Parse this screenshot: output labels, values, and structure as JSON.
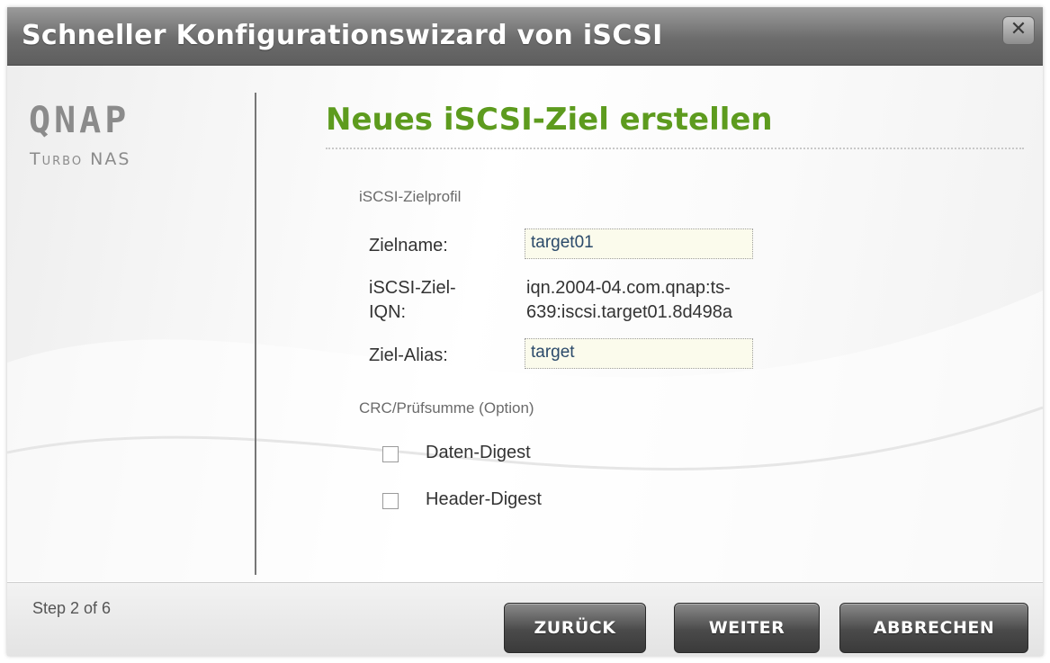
{
  "window": {
    "title": "Schneller Konfigurationswizard von iSCSI",
    "close_glyph": "✕"
  },
  "branding": {
    "logo": "QNAP",
    "subtitle": "Turbo NAS"
  },
  "main": {
    "heading": "Neues iSCSI-Ziel erstellen",
    "profile_section": "iSCSI-Zielprofil",
    "fields": {
      "target_name_label": "Zielname:",
      "target_name_value": "target01",
      "iqn_label_line1": "iSCSI-Ziel-",
      "iqn_label_line2": "IQN:",
      "iqn_value_line1": "iqn.2004-04.com.qnap:ts-",
      "iqn_value_line2": "639:iscsi.target01.8d498a",
      "alias_label": "Ziel-Alias:",
      "alias_value": "target"
    },
    "crc_section": "CRC/Prüfsumme (Option)",
    "checkboxes": {
      "data_digest": "Daten-Digest",
      "header_digest": "Header-Digest"
    }
  },
  "footer": {
    "step": "Step 2 of 6",
    "back_label": "ZURÜCK",
    "next_label": "WEITER",
    "cancel_label": "ABBRECHEN"
  },
  "colors": {
    "heading_green": "#5d9b1e",
    "titlebar": "#6c6c6c",
    "button": "#4a4a4a"
  },
  "icons": {
    "close": "close-icon"
  }
}
